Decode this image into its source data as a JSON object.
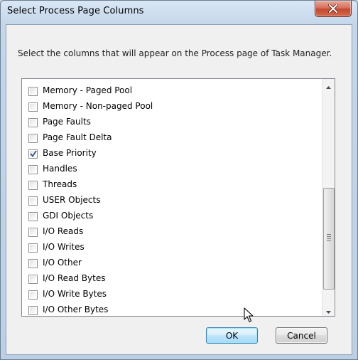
{
  "window": {
    "title": "Select Process Page Columns",
    "close_icon": "close-icon"
  },
  "instruction": "Select the columns that will appear on the Process page of Task Manager.",
  "columns": [
    {
      "label": "Memory - Paged Pool",
      "checked": false
    },
    {
      "label": "Memory - Non-paged Pool",
      "checked": false
    },
    {
      "label": "Page Faults",
      "checked": false
    },
    {
      "label": "Page Fault Delta",
      "checked": false
    },
    {
      "label": "Base Priority",
      "checked": true
    },
    {
      "label": "Handles",
      "checked": false
    },
    {
      "label": "Threads",
      "checked": false
    },
    {
      "label": "USER Objects",
      "checked": false
    },
    {
      "label": "GDI Objects",
      "checked": false
    },
    {
      "label": "I/O Reads",
      "checked": false
    },
    {
      "label": "I/O Writes",
      "checked": false
    },
    {
      "label": "I/O Other",
      "checked": false
    },
    {
      "label": "I/O Read Bytes",
      "checked": false
    },
    {
      "label": "I/O Write Bytes",
      "checked": false
    },
    {
      "label": "I/O Other Bytes",
      "checked": false
    }
  ],
  "buttons": {
    "ok_label": "OK",
    "cancel_label": "Cancel"
  },
  "colors": {
    "ok_accent": "#3c7fb1",
    "close_red": "#c34a30"
  }
}
